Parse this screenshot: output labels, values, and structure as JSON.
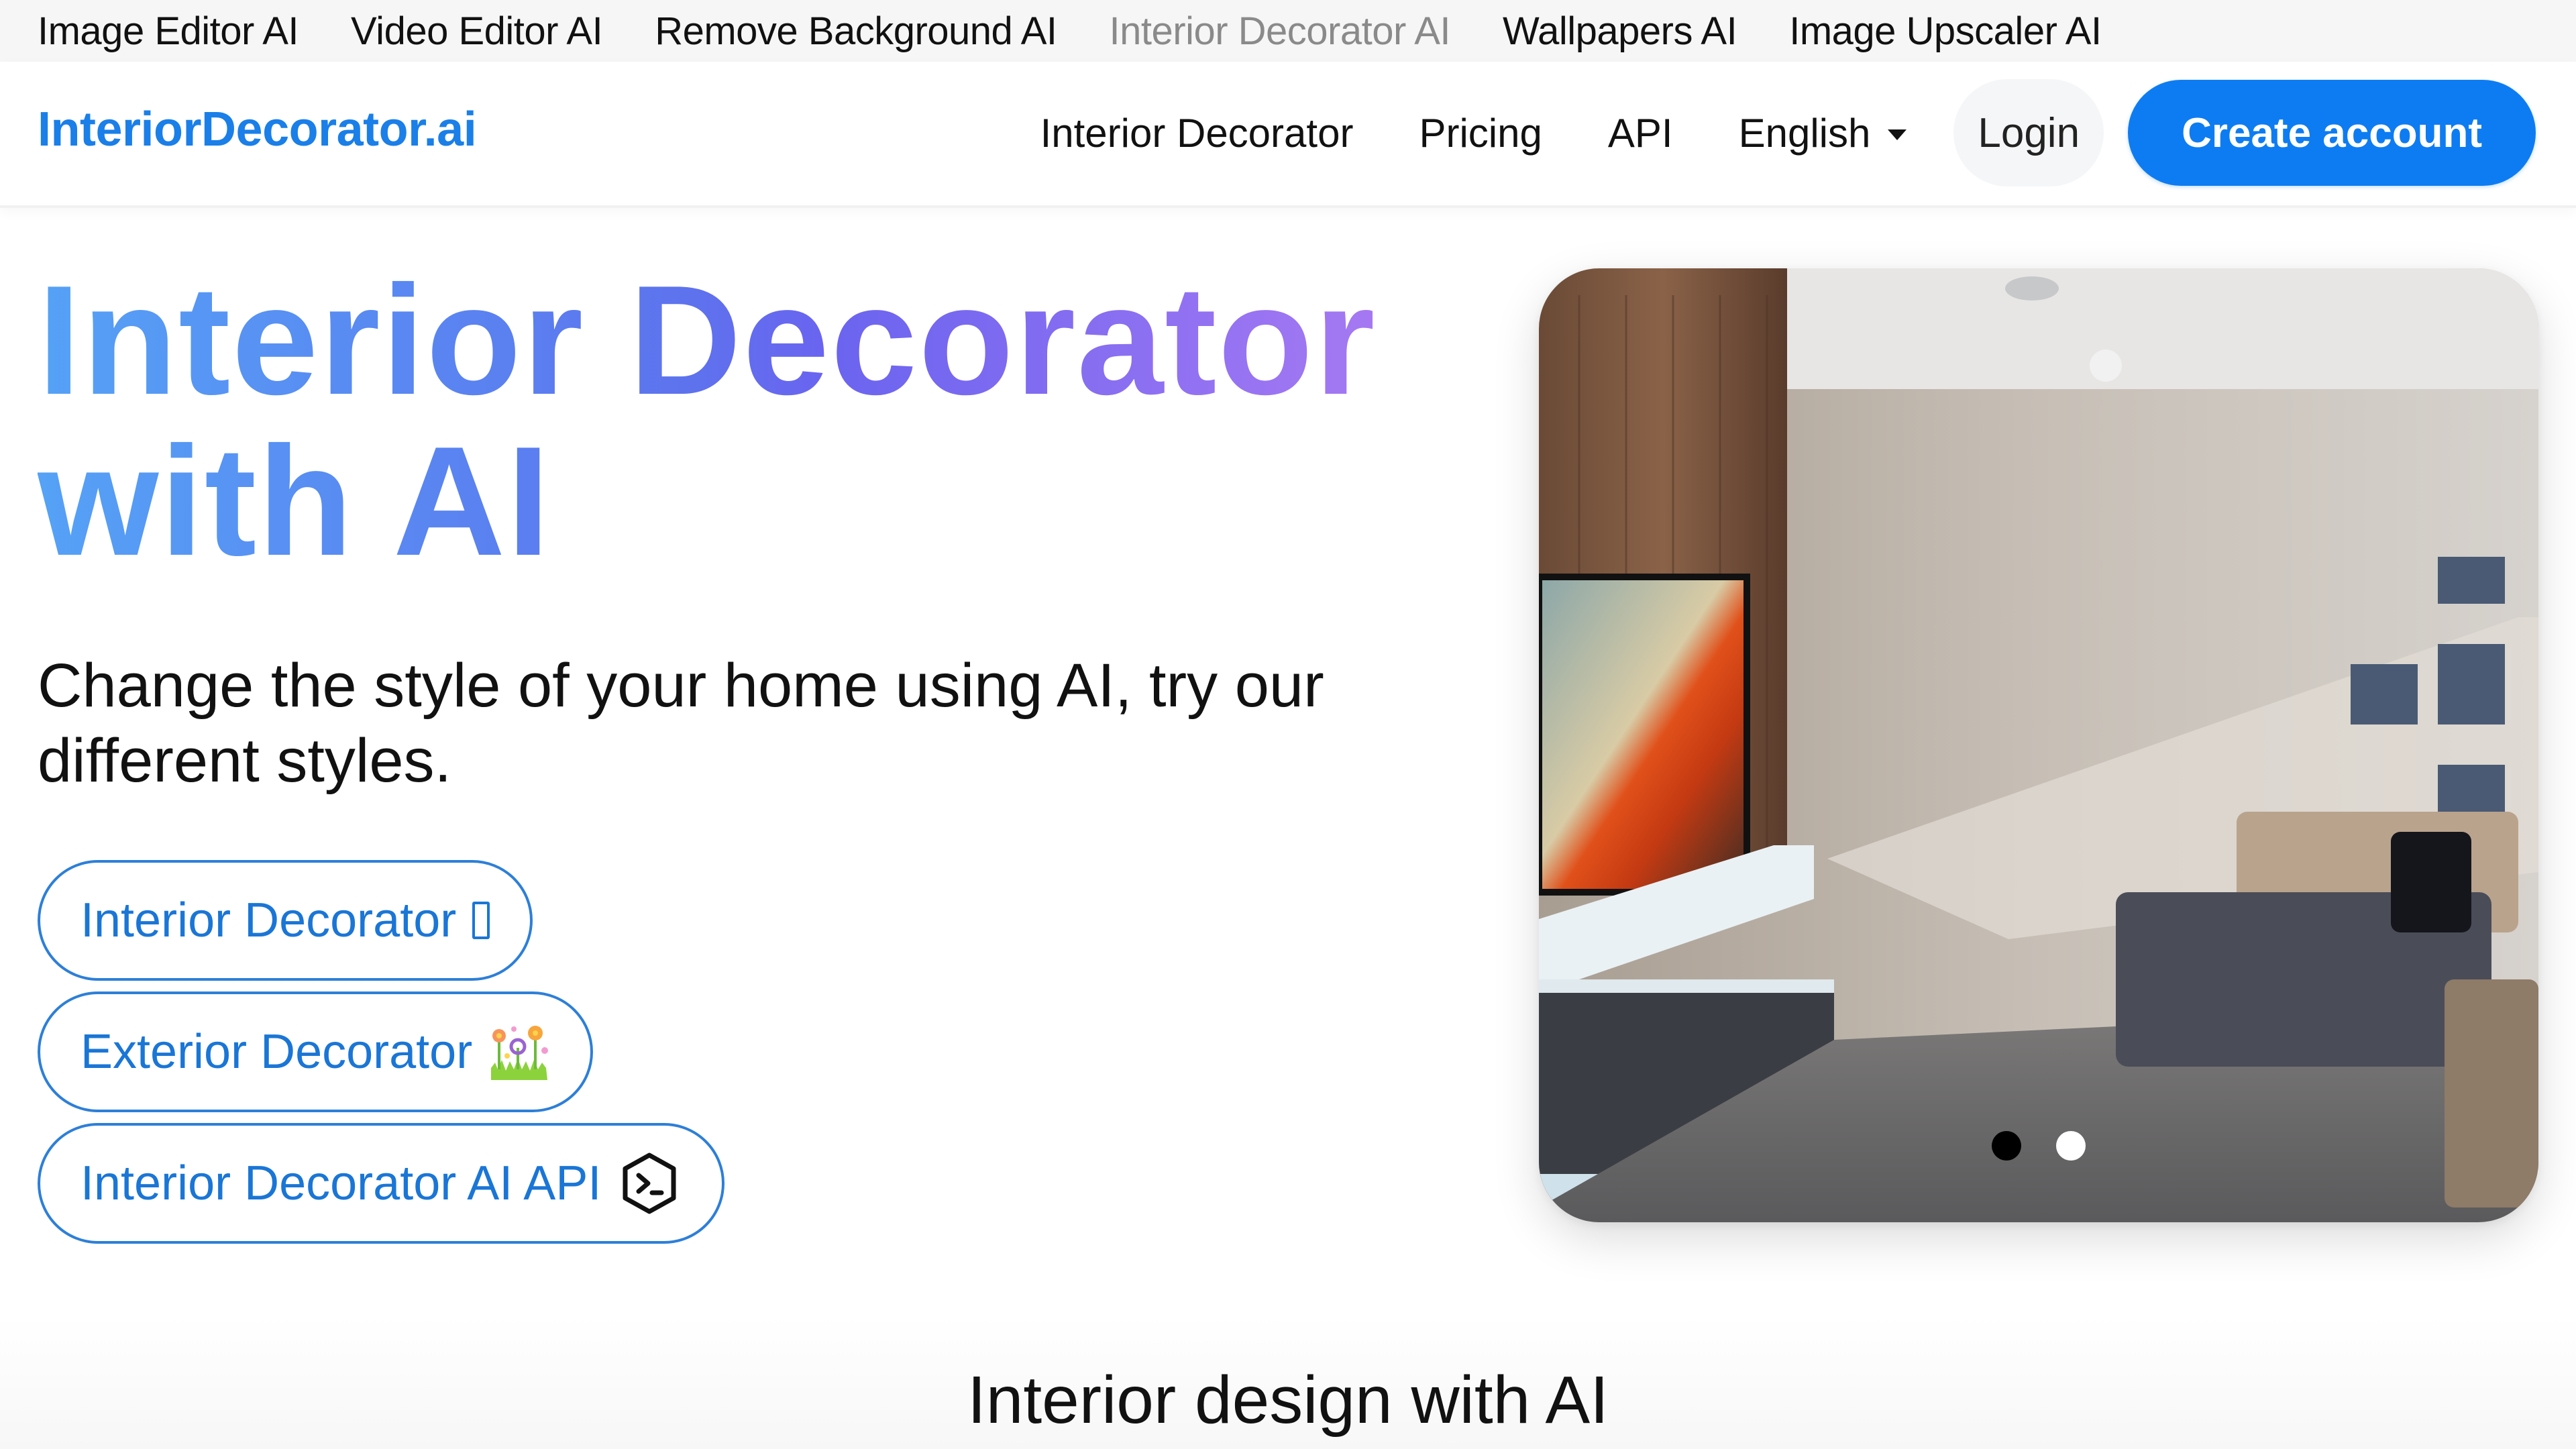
{
  "apps_bar": {
    "items": [
      {
        "label": "Image Editor AI",
        "current": false
      },
      {
        "label": "Video Editor AI",
        "current": false
      },
      {
        "label": "Remove Background AI",
        "current": false
      },
      {
        "label": "Interior Decorator AI",
        "current": true
      },
      {
        "label": "Wallpapers AI",
        "current": false
      },
      {
        "label": "Image Upscaler AI",
        "current": false
      }
    ]
  },
  "nav": {
    "brand": "InteriorDecorator.ai",
    "links": [
      "Interior Decorator",
      "Pricing",
      "API"
    ],
    "language": {
      "selected": "English",
      "icon": "caret-down-icon"
    },
    "login_label": "Login",
    "create_account_label": "Create account",
    "accent_color": "#0d7cf2"
  },
  "hero": {
    "title_line1": "Interior Decorator",
    "title_line2": "with AI",
    "title_gradient": [
      "#55a2f6",
      "#6a64f0",
      "#b07cf3"
    ],
    "subtitle": "Change the style of your home using AI, try our different styles.",
    "ctas": [
      {
        "label": "Interior Decorator",
        "icon": "missing-glyph-icon",
        "glyph": ""
      },
      {
        "label": "Exterior Decorator",
        "icon": "flowers-garden-icon",
        "glyph": ""
      },
      {
        "label": "Interior Decorator AI API",
        "icon": "terminal-hexagon-icon",
        "glyph": ""
      }
    ],
    "carousel": {
      "image_alt": "Modern living room with TV wall, sectional sofa and wall shelves",
      "slides": 2,
      "active_slide": 1
    }
  },
  "section": {
    "title": "Interior design with AI"
  }
}
